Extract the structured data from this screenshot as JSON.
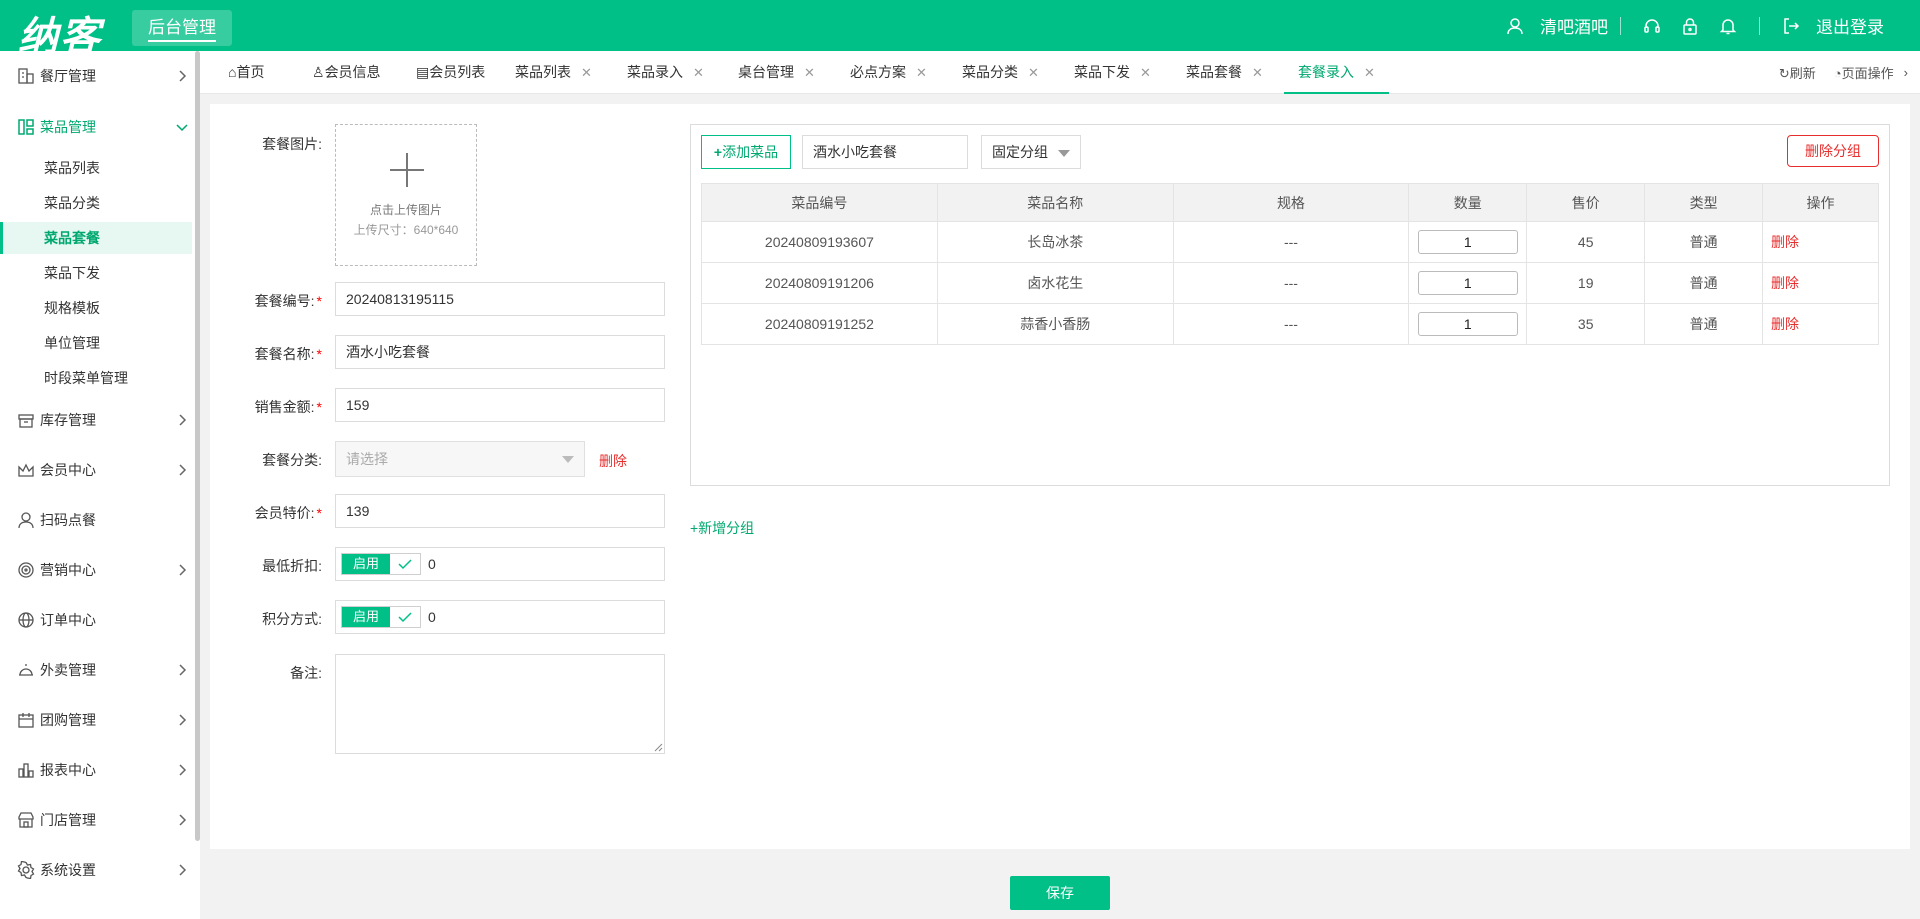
{
  "header": {
    "logo": "纳客",
    "admin_label": "后台管理",
    "user_name": "清吧酒吧",
    "logout": "退出登录"
  },
  "sidebar": {
    "items": [
      {
        "label": "餐厅管理"
      },
      {
        "label": "菜品管理"
      },
      {
        "label": "库存管理"
      },
      {
        "label": "会员中心"
      },
      {
        "label": "扫码点餐"
      },
      {
        "label": "营销中心"
      },
      {
        "label": "订单中心"
      },
      {
        "label": "外卖管理"
      },
      {
        "label": "团购管理"
      },
      {
        "label": "报表中心"
      },
      {
        "label": "门店管理"
      },
      {
        "label": "系统设置"
      }
    ],
    "sub_items": [
      {
        "label": "菜品列表"
      },
      {
        "label": "菜品分类"
      },
      {
        "label": "菜品套餐"
      },
      {
        "label": "菜品下发"
      },
      {
        "label": "规格模板"
      },
      {
        "label": "单位管理"
      },
      {
        "label": "时段菜单管理"
      }
    ]
  },
  "tabs": [
    {
      "label": "首页"
    },
    {
      "label": "会员信息"
    },
    {
      "label": "会员列表"
    },
    {
      "label": "菜品列表"
    },
    {
      "label": "菜品录入"
    },
    {
      "label": "桌台管理"
    },
    {
      "label": "必点方案"
    },
    {
      "label": "菜品分类"
    },
    {
      "label": "菜品下发"
    },
    {
      "label": "菜品套餐"
    },
    {
      "label": "套餐录入"
    }
  ],
  "tab_actions": {
    "refresh": "刷新",
    "page_ops": "页面操作"
  },
  "form": {
    "image_label": "套餐图片:",
    "upload_hint": "点击上传图片",
    "upload_size": "上传尺寸：640*640",
    "code_label": "套餐编号:",
    "code_value": "20240813195115",
    "name_label": "套餐名称:",
    "name_value": "酒水小吃套餐",
    "price_label": "销售金额:",
    "price_value": "159",
    "category_label": "套餐分类:",
    "category_placeholder": "请选择",
    "category_delete": "删除",
    "member_price_label": "会员特价:",
    "member_price_value": "139",
    "min_discount_label": "最低折扣:",
    "min_discount_toggle": "启用",
    "min_discount_value": "0",
    "points_label": "积分方式:",
    "points_toggle": "启用",
    "points_value": "0",
    "remark_label": "备注:"
  },
  "group": {
    "add_dish": "添加菜品",
    "group_name": "酒水小吃套餐",
    "group_type": "固定分组",
    "delete_group": "删除分组",
    "columns": [
      "菜品编号",
      "菜品名称",
      "规格",
      "数量",
      "售价",
      "类型",
      "操作"
    ],
    "rows": [
      {
        "code": "20240809193607",
        "name": "长岛冰茶",
        "spec": "---",
        "qty": "1",
        "price": "45",
        "type": "普通",
        "op": "删除"
      },
      {
        "code": "20240809191206",
        "name": "卤水花生",
        "spec": "---",
        "qty": "1",
        "price": "19",
        "type": "普通",
        "op": "删除"
      },
      {
        "code": "20240809191252",
        "name": "蒜香小香肠",
        "spec": "---",
        "qty": "1",
        "price": "35",
        "type": "普通",
        "op": "删除"
      }
    ],
    "add_group": "+新增分组"
  },
  "footer": {
    "save": "保存"
  },
  "colors": {
    "brand": "#00bf87",
    "danger": "#e62e2e"
  }
}
